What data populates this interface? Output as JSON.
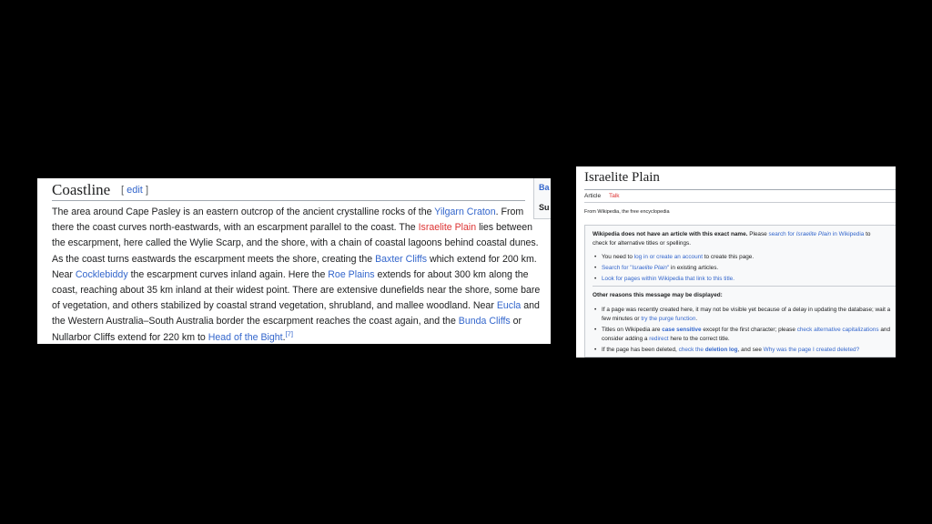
{
  "left": {
    "heading": "Coastline",
    "edit_open": "[",
    "edit_label": "edit",
    "edit_close": "]",
    "para": {
      "t1": "The area around Cape Pasley is an eastern outcrop of the ancient crystalline rocks of the ",
      "l1": "Yilgarn Craton",
      "t2": ". From there the coast curves north-eastwards, with an escarpment parallel to the coast. The ",
      "l2": "Israelite Plain",
      "t3": " lies between the escarpment, here called the Wylie Scarp, and the shore, with a chain of coastal lagoons behind coastal dunes. As the coast turns eastwards the escarpment meets the shore, creating the ",
      "l3": "Baxter Cliffs",
      "t4": " which extend for 200 km. Near ",
      "l4": "Cocklebiddy",
      "t5": " the escarpment curves inland again. Here the ",
      "l5": "Roe Plains",
      "t6": " extends for about 300 km along the coast, reaching about 35 km inland at their widest point. There are extensive dunefields near the shore, some bare of vegetation, and others stabilized by coastal strand vegetation, shrubland, and mallee woodland. Near ",
      "l6": "Eucla",
      "t7": " and the Western Australia–South Australia border the escarpment reaches the coast again, and the ",
      "l7": "Bunda Cliffs",
      "t8": " or Nullarbor Cliffs extend for 220 km to ",
      "l8": "Head of the Bight",
      "t9": ".",
      "ref": "[7]"
    },
    "side": {
      "s1": "Ba",
      "s2": "Su"
    }
  },
  "right": {
    "title": "Israelite Plain",
    "tab_article": "Article",
    "tab_talk": "Talk",
    "from": "From Wikipedia, the free encyclopedia",
    "notice": {
      "bold": "Wikipedia does not have an article with this exact name.",
      "t1": " Please ",
      "l1": "search for ",
      "l1i": "Israelite Plain",
      "l1b": " in Wikipedia",
      "t2": " to check for alternative titles or spellings."
    },
    "list1": {
      "i1a": "You need to ",
      "i1l1": "log in or create an account",
      "i1b": " to create this page.",
      "i2l": "Search for \"",
      "i2i": "Israelite Plain",
      "i2l2": "\"",
      "i2b": " in existing articles.",
      "i3l": "Look for pages within Wikipedia that link to this title."
    },
    "other_heading": "Other reasons this message may be displayed:",
    "list2": {
      "a1": "If a page was recently created here, it may not be visible yet because of a delay in updating the database; wait a few minutes or ",
      "a1l": "try the purge function",
      "a1e": ".",
      "b1": "Titles on Wikipedia are ",
      "b1l": "case sensitive",
      "b2": " except for the first character; please ",
      "b2l": "check alternative capitalizations",
      "b3": " and consider adding a ",
      "b3l": "redirect",
      "b4": " here to the correct title.",
      "c1": "If the page has been deleted, ",
      "c1l": "check the ",
      "c1lb": "deletion log",
      "c2": ", and see ",
      "c2l": "Why was the page I created deleted?"
    }
  }
}
